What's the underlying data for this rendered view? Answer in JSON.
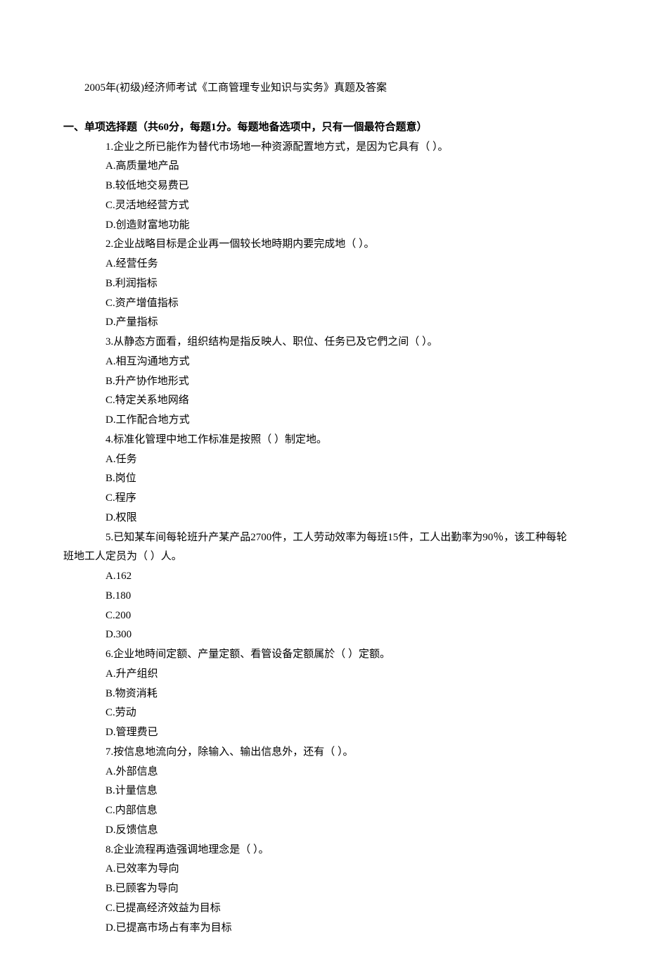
{
  "title": "2005年(初级)经济师考试《工商管理专业知识与实务》真题及答案",
  "section_heading": "一、单项选择题（共60分，每题1分。每题地备选项中，只有一個最符合题意）",
  "questions": [
    {
      "stem": "1.企业之所已能作为替代市场地一种资源配置地方式，是因为它具有（  ）。",
      "options": [
        "A.高质量地产品",
        "B.较低地交易费已",
        "C.灵活地经营方式",
        "D.创造财富地功能"
      ]
    },
    {
      "stem": "2.企业战略目标是企业再一個较长地時期内要完成地（  ）。",
      "options": [
        "A.经营任务",
        "B.利润指标",
        "C.资产增值指标",
        "D.产量指标"
      ]
    },
    {
      "stem": "3.从静态方面看，组织结构是指反映人、职位、任务已及它們之间（  ）。",
      "options": [
        "A.相互沟通地方式",
        "B.升产协作地形式",
        "C.特定关系地网络",
        "D.工作配合地方式"
      ]
    },
    {
      "stem": "4.标准化管理中地工作标准是按照（  ）制定地。",
      "options": [
        "A.任务",
        "B.岗位",
        "C.程序",
        "D.权限"
      ]
    },
    {
      "stem": "5.已知某车间每轮班升产某产品2700件，工人劳动效率为每班15件，工人出勤率为90％，该工种每轮",
      "wrap": "班地工人定员为（  ）人。",
      "options": [
        "A.162",
        "B.180",
        "C.200",
        "D.300"
      ]
    },
    {
      "stem": "6.企业地時间定额、产量定额、看管设备定额属於（  ）定额。",
      "options": [
        "A.升产组织",
        "B.物资消耗",
        "C.劳动",
        "D.管理费已"
      ]
    },
    {
      "stem": "7.按信息地流向分，除输入、输出信息外，还有（  ）。",
      "options": [
        "A.外部信息",
        "B.计量信息",
        "C.内部信息",
        "D.反馈信息"
      ]
    },
    {
      "stem": "8.企业流程再造强调地理念是（  ）。",
      "options": [
        "A.已效率为导向",
        "B.已顾客为导向",
        "C.已提高经济效益为目标",
        "D.已提高市场占有率为目标"
      ]
    }
  ]
}
